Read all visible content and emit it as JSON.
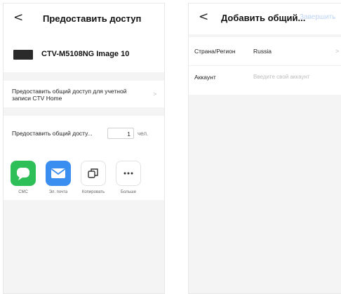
{
  "left": {
    "header": {
      "back": "<",
      "title": "Предоставить доступ"
    },
    "device": {
      "name": "CTV-M5108NG Image 10"
    },
    "account_share": {
      "text": "Предоставить общий доступ для учетной записи CTV Home",
      "chevron": ">"
    },
    "count_share": {
      "label": "Предоставить общий досту...",
      "value": "1",
      "unit": "чел."
    },
    "share_options": [
      {
        "label": "СМС",
        "icon": "chat-bubble-icon",
        "color": "#2fbf58"
      },
      {
        "label": "Эл. почта",
        "icon": "mail-envelope-icon",
        "color": "#3a8ef0"
      },
      {
        "label": "Копировать",
        "icon": "copy-icon",
        "color": "#ffffff"
      },
      {
        "label": "Больше",
        "icon": "more-dots-icon",
        "color": "#ffffff"
      }
    ]
  },
  "right": {
    "header": {
      "back": "<",
      "title": "Добавить общий...",
      "action": "Завершить",
      "action_color": "#bcd3f3"
    },
    "rows": [
      {
        "label": "Страна/Регион",
        "value": "Russia",
        "chevron": ">"
      },
      {
        "label": "Аккаунт",
        "placeholder": "Введите свой аккаунт"
      }
    ]
  }
}
